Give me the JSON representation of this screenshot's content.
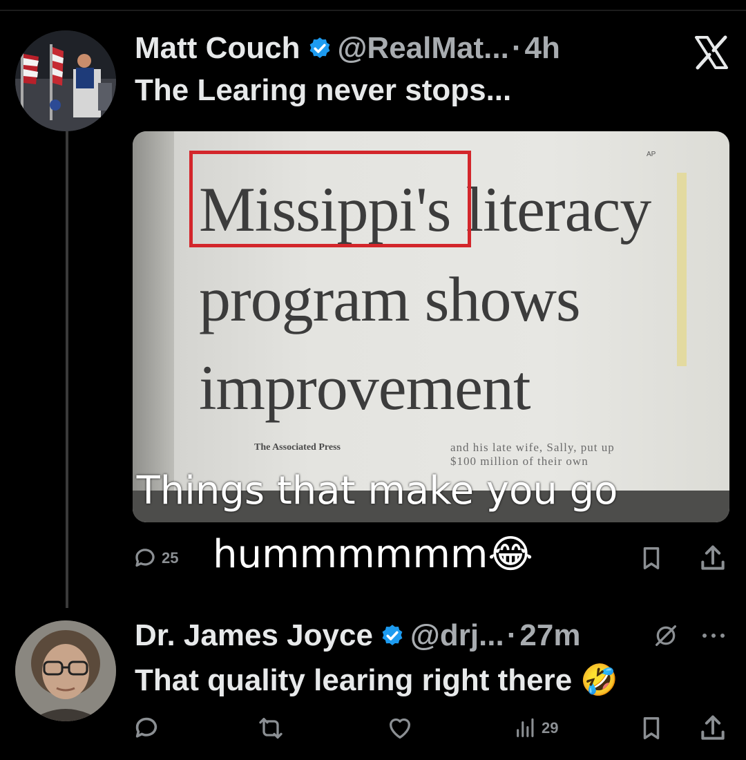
{
  "tweet1": {
    "author_name": "Matt Couch",
    "handle": "@RealMat...",
    "separator": "·",
    "time": "4h",
    "text": "The Learing never stops...",
    "media": {
      "headline_line1_word1": "Missippi's",
      "headline_line1_word2": "literacy",
      "headline_line2": "program shows",
      "headline_line3": "improvement",
      "byline": "The Associated Press",
      "body_line1": "and his late wife, Sally, put up",
      "body_line2": "$100 million of their own",
      "ap_mark": "AP"
    },
    "reply_count": "25"
  },
  "overlay_caption": {
    "line1": "Things that make you go",
    "line2": "hummmmmm",
    "emoji": "😂"
  },
  "tweet2": {
    "author_name": "Dr. James Joyce",
    "handle": "@drj...",
    "separator": "·",
    "time": "27m",
    "text": "That quality learing right there",
    "emoji": "🤣",
    "views_count": "29"
  },
  "icons": {
    "x_logo": "x-logo-icon",
    "verified": "verified-badge-icon",
    "reply": "reply-icon",
    "retweet": "retweet-icon",
    "like": "heart-icon",
    "views": "views-icon",
    "bookmark": "bookmark-icon",
    "share": "share-icon",
    "grok": "grok-icon",
    "more": "more-icon"
  },
  "colors": {
    "background": "#000000",
    "verified_blue": "#1d9bf0",
    "muted_text": "#a8acb0",
    "headline_box_red": "#d3262b"
  }
}
